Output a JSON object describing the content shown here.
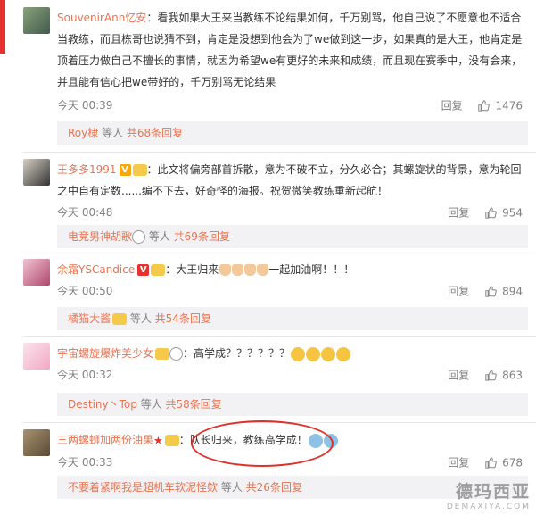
{
  "comments": [
    {
      "user": "SouvenirAnn忆安",
      "text": "：看我如果大王来当教练不论结果如何，千万别骂，他自己说了不愿意也不适合当教练，而且栋哥也说猜不到，肯定是没想到他会为了we做到这一步，如果真的是大王，他肯定是顶着压力做自己不擅长的事情，就因为希望we有更好的未来和成绩，而且现在赛季中，没有会来，并且能有信心把we带好的，千万别骂无论结果",
      "time": "今天 00:39",
      "reply_label": "回复",
      "likes": "1476",
      "replies": {
        "users": "Roy棣",
        "suffix": " 等人",
        "count": "共68条回复"
      }
    },
    {
      "user": "王多多1991",
      "text": "：此文将偏旁部首拆散，意为不破不立，分久必合；其螺旋状的背景，意为轮回之中自有定数......编不下去，好奇怪的海报。祝贺微笑教练重新起航！",
      "time": "今天 00:48",
      "reply_label": "回复",
      "likes": "954",
      "replies": {
        "users": "电竞男神胡歌",
        "suffix": " 等人",
        "count": "共69条回复"
      }
    },
    {
      "user": "余霜YSCandice",
      "text": "：大王归来",
      "text_tail": "一起加油啊！！！",
      "time": "今天 00:50",
      "reply_label": "回复",
      "likes": "894",
      "replies": {
        "users": "橘猫大酱",
        "suffix": " 等人",
        "count": "共54条回复"
      }
    },
    {
      "user": "宇宙螺旋爆炸美少女",
      "text": "：高学成？？？？？？",
      "time": "今天 00:32",
      "reply_label": "回复",
      "likes": "863",
      "replies": {
        "users": "Destiny丶Top",
        "suffix": " 等人",
        "count": "共58条回复"
      }
    },
    {
      "user": "三两螺蛳加两份油果",
      "text": "：队长归来，教练高学成！",
      "time": "今天 00:33",
      "reply_label": "回复",
      "likes": "678",
      "replies": {
        "users": "不要着紧啊我是超机车软泥怪欸",
        "suffix": " 等人",
        "count": "共26条回复"
      }
    }
  ],
  "watermark": {
    "cn": "德玛西亚",
    "en": "DEMAXIYA.COM"
  },
  "colors": {
    "username": "#eb7350",
    "accent_red": "#e8312f",
    "meta": "#808080",
    "reply_bg": "#f2f2f5"
  }
}
